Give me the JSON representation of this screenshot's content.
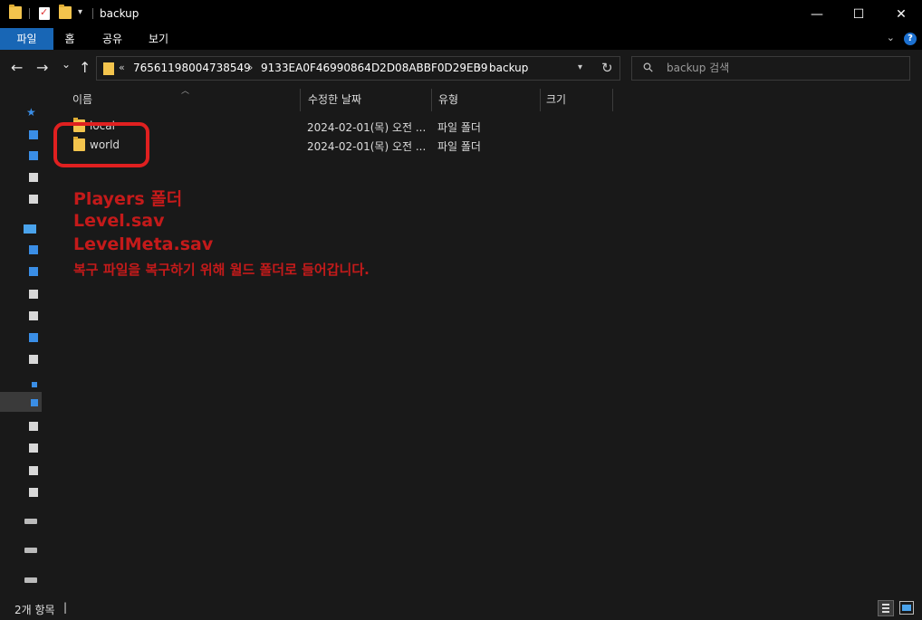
{
  "window": {
    "title": "backup",
    "qa_dropdown_icon": "chevron-down-icon",
    "minimize_glyph": "—",
    "maximize_glyph": "☐",
    "close_glyph": "✕"
  },
  "ribbon": {
    "tabs": [
      {
        "label": "파일",
        "active": true
      },
      {
        "label": "홈"
      },
      {
        "label": "공유"
      },
      {
        "label": "보기"
      }
    ],
    "help_label": "?"
  },
  "nav": {
    "back_glyph": "←",
    "forward_glyph": "→",
    "recent_glyph": "⌄",
    "up_glyph": "↑",
    "breadcrumb": [
      "76561198004738549",
      "9133EA0F46990864D2D08ABBF0D29EB9",
      "backup"
    ],
    "overflow_glyph": "«",
    "separator_glyph": "›",
    "refresh_glyph": "↻",
    "search_placeholder": "backup 검색"
  },
  "columns": {
    "name": "이름",
    "date": "수정한 날짜",
    "type": "유형",
    "size": "크기"
  },
  "files": [
    {
      "name": "local",
      "date": "2024-02-01(목) 오전 ...",
      "type": "파일 폴더",
      "size": ""
    },
    {
      "name": "world",
      "date": "2024-02-01(목) 오전 ...",
      "type": "파일 폴더",
      "size": ""
    }
  ],
  "annotation": {
    "highlight_color": "#e02020",
    "text_color": "#c41a1a",
    "lines": [
      "Players 폴더",
      "Level.sav",
      "LevelMeta.sav",
      "복구 파일을 복구하기 위해 월드 폴더로 들어갑니다."
    ]
  },
  "status": {
    "item_count": "2개 항목",
    "caret": "|"
  },
  "colors": {
    "background": "#191919",
    "titlebar": "#000000",
    "active_tab": "#1866b5",
    "folder": "#f3c44d"
  }
}
